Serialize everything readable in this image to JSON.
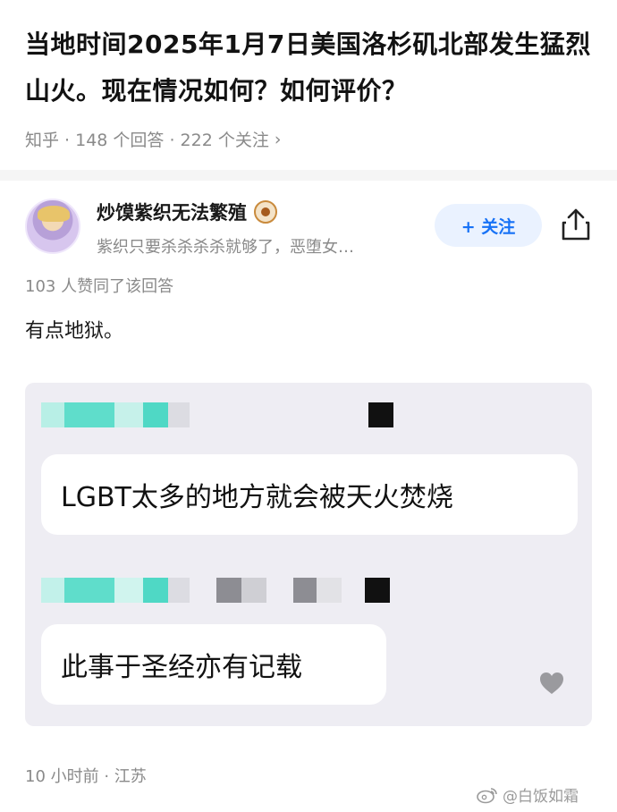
{
  "question": {
    "title": "当地时间2025年1月7日美国洛杉矶北部发生猛烈山火。现在情况如何？如何评价？",
    "meta": "知乎 · 148 个回答 · 222 个关注",
    "chevron": "›"
  },
  "answer": {
    "author_name": "炒馍紫织无法繁殖",
    "author_bio": "紫织只要杀杀杀杀就够了，恶堕女…",
    "follow_label": "+ 关注",
    "upvote_text": "103 人赞同了该回答",
    "body_text": "有点地狱。",
    "time_location": "10 小时前 · 江苏"
  },
  "screenshot": {
    "message_1": "LGBT太多的地方就会被天火焚烧",
    "message_2": "此事于圣经亦有记载"
  },
  "watermark": {
    "text": "@白饭如霜",
    "icon": "weibo-icon"
  },
  "colors": {
    "accent": "#1772f6",
    "follow_bg": "#eaf2ff",
    "meta_gray": "#8a8a8a",
    "screenshot_bg": "#eeedf3"
  }
}
